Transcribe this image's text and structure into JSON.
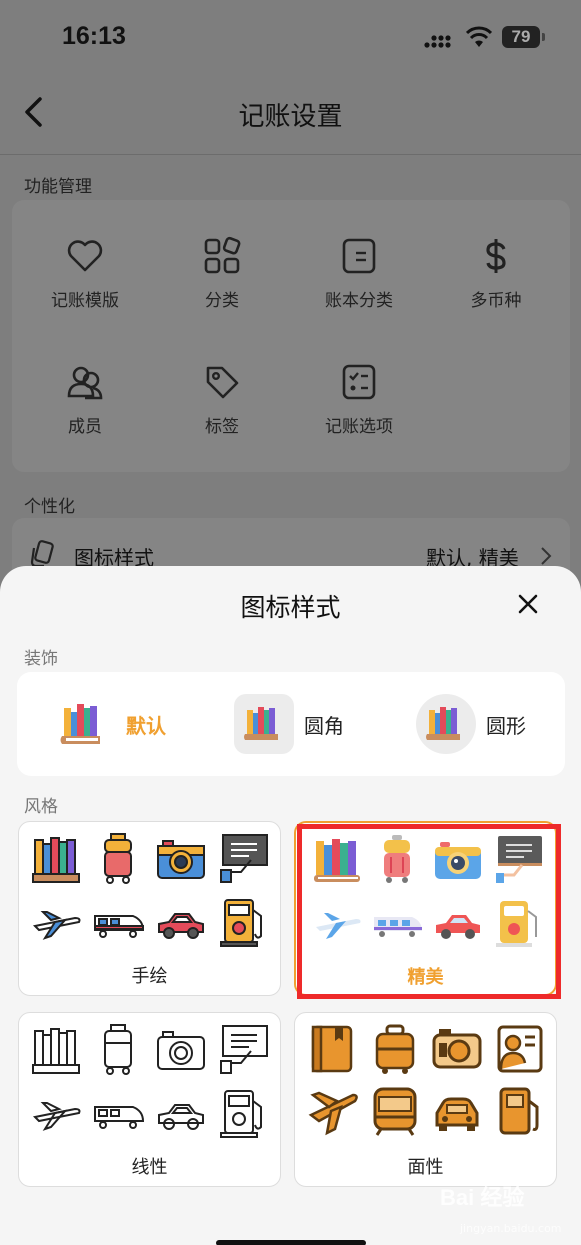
{
  "status_bar": {
    "time": "16:13",
    "battery": "79"
  },
  "nav": {
    "title": "记账设置"
  },
  "sections": {
    "function": "功能管理",
    "personal": "个性化"
  },
  "functions": [
    {
      "label": "记账模版",
      "icon": "heart-icon"
    },
    {
      "label": "分类",
      "icon": "category-grid-icon"
    },
    {
      "label": "账本分类",
      "icon": "ledger-icon"
    },
    {
      "label": "多币种",
      "icon": "dollar-icon"
    },
    {
      "label": "成员",
      "icon": "members-icon"
    },
    {
      "label": "标签",
      "icon": "tag-icon"
    },
    {
      "label": "记账选项",
      "icon": "checklist-icon"
    }
  ],
  "icon_style_row": {
    "label": "图标样式",
    "value": "默认, 精美"
  },
  "sheet": {
    "title": "图标样式",
    "decoration_label": "装饰",
    "decorations": [
      {
        "label": "默认",
        "selected": true
      },
      {
        "label": "圆角",
        "selected": false
      },
      {
        "label": "圆形",
        "selected": false
      }
    ],
    "style_label": "风格",
    "styles": [
      {
        "label": "手绘",
        "selected": false
      },
      {
        "label": "精美",
        "selected": true
      },
      {
        "label": "线性",
        "selected": false
      },
      {
        "label": "面性",
        "selected": false
      }
    ]
  },
  "watermark": {
    "brand": "Bai 经验",
    "url": "jingyan.baidu.com"
  },
  "colors": {
    "accent": "#f0a030",
    "highlight": "#ee2a2a"
  }
}
